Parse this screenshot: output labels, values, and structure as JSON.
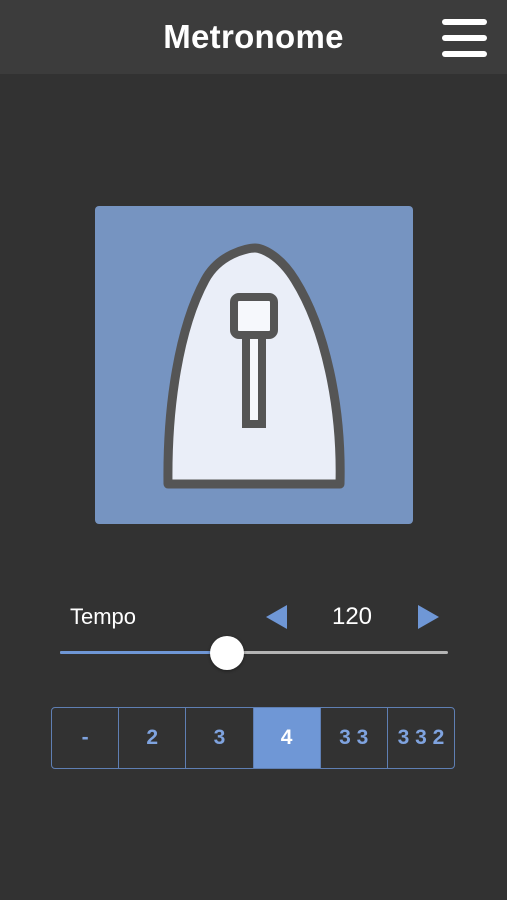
{
  "header": {
    "title": "Metronome",
    "menu_icon": "hamburger-menu-icon"
  },
  "artwork": {
    "icon": "metronome-icon",
    "background_color": "#7694c1"
  },
  "tempo": {
    "label": "Tempo",
    "value": "120",
    "decrease_icon": "triangle-left-icon",
    "increase_icon": "triangle-right-icon",
    "slider_fraction": 0.43,
    "accent_color": "#6f97d6"
  },
  "beat_patterns": {
    "options": [
      "-",
      "2",
      "3",
      "4",
      "3 3",
      "3 3 2"
    ],
    "selected": "4"
  }
}
